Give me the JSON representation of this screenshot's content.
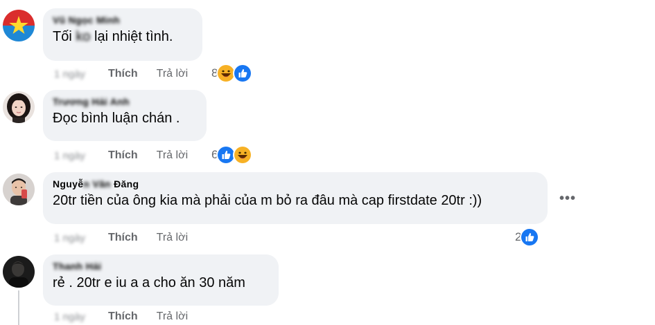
{
  "comments": [
    {
      "author": "Vũ Ngọc Minh",
      "text_pre": "Tối ",
      "text_blur": "ko",
      "text_post": " lại nhiệt tình.",
      "time": "1 ngày",
      "like_label": "Thích",
      "reply_label": "Trả lời",
      "reaction_count": "8",
      "reactions": [
        "haha-icon",
        "like-icon"
      ]
    },
    {
      "author": "Trương Hải Anh",
      "text": "Đọc bình luận chán .",
      "time": "1 ngày",
      "like_label": "Thích",
      "reply_label": "Trả lời",
      "reaction_count": "6",
      "reactions": [
        "like-icon",
        "haha-icon"
      ]
    },
    {
      "author_visible": "Nguyễ",
      "author_blur": "n Văn",
      "author_visible2": " Đăng",
      "text": "20tr tiền của ông kia mà phải của m bỏ ra đâu mà cap firstdate 20tr :))",
      "time": "1 ngày",
      "like_label": "Thích",
      "reply_label": "Trả lời",
      "reaction_count": "2",
      "reactions": [
        "like-icon"
      ],
      "more_label": "•••"
    },
    {
      "author": "Thanh Hải",
      "text": "rẻ . 20tr e iu a a cho ăn 30 năm",
      "time": "1 ngày",
      "like_label": "Thích",
      "reply_label": "Trả lời"
    }
  ],
  "colors": {
    "bubble": "#f0f2f5",
    "meta": "#65676b",
    "like_blue": "#1877f2",
    "haha_yellow": "#f7b125"
  }
}
